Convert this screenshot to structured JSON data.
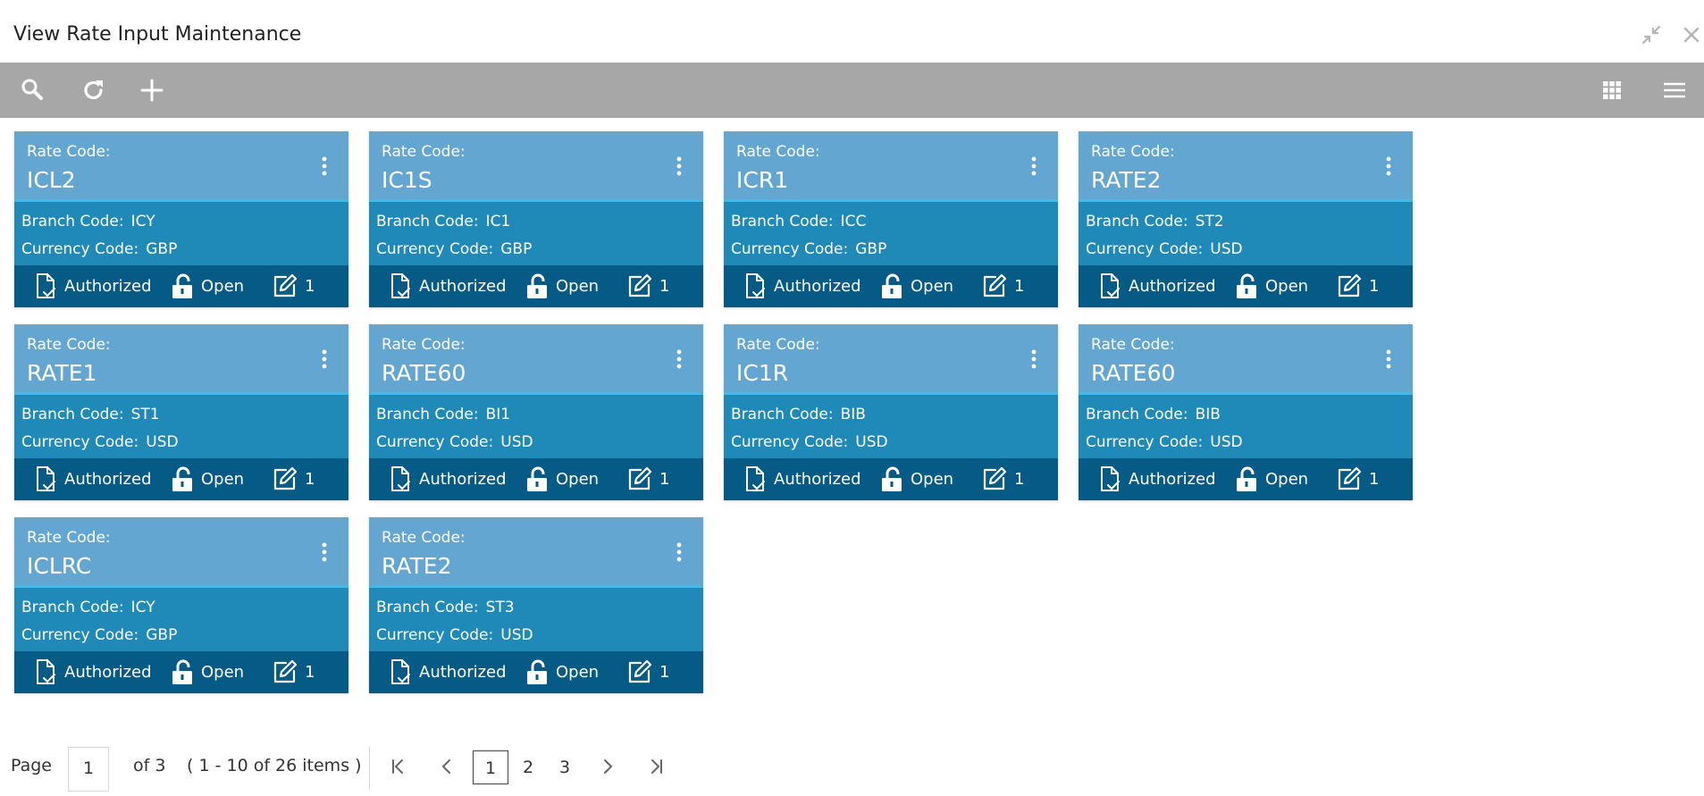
{
  "window": {
    "title": "View Rate Input Maintenance"
  },
  "toolbar": {
    "search_icon": "search-icon",
    "refresh_icon": "refresh-icon",
    "add_icon": "plus-icon",
    "tile_view_icon": "grid-icon",
    "list_view_icon": "menu-icon"
  },
  "cards": [
    {
      "rate_label": "Rate Code:",
      "rate_code": "ICL2",
      "branch_label": "Branch Code:",
      "branch_code": "ICY",
      "currency_label": "Currency Code:",
      "currency_code": "GBP",
      "auth_status": "Authorized",
      "record_status": "Open",
      "mod_no": "1"
    },
    {
      "rate_label": "Rate Code:",
      "rate_code": "IC1S",
      "branch_label": "Branch Code:",
      "branch_code": "IC1",
      "currency_label": "Currency Code:",
      "currency_code": "GBP",
      "auth_status": "Authorized",
      "record_status": "Open",
      "mod_no": "1"
    },
    {
      "rate_label": "Rate Code:",
      "rate_code": "ICR1",
      "branch_label": "Branch Code:",
      "branch_code": "ICC",
      "currency_label": "Currency Code:",
      "currency_code": "GBP",
      "auth_status": "Authorized",
      "record_status": "Open",
      "mod_no": "1"
    },
    {
      "rate_label": "Rate Code:",
      "rate_code": "RATE2",
      "branch_label": "Branch Code:",
      "branch_code": "ST2",
      "currency_label": "Currency Code:",
      "currency_code": "USD",
      "auth_status": "Authorized",
      "record_status": "Open",
      "mod_no": "1"
    },
    {
      "rate_label": "Rate Code:",
      "rate_code": "RATE1",
      "branch_label": "Branch Code:",
      "branch_code": "ST1",
      "currency_label": "Currency Code:",
      "currency_code": "USD",
      "auth_status": "Authorized",
      "record_status": "Open",
      "mod_no": "1"
    },
    {
      "rate_label": "Rate Code:",
      "rate_code": "RATE60",
      "branch_label": "Branch Code:",
      "branch_code": "BI1",
      "currency_label": "Currency Code:",
      "currency_code": "USD",
      "auth_status": "Authorized",
      "record_status": "Open",
      "mod_no": "1"
    },
    {
      "rate_label": "Rate Code:",
      "rate_code": "IC1R",
      "branch_label": "Branch Code:",
      "branch_code": "BIB",
      "currency_label": "Currency Code:",
      "currency_code": "USD",
      "auth_status": "Authorized",
      "record_status": "Open",
      "mod_no": "1"
    },
    {
      "rate_label": "Rate Code:",
      "rate_code": "RATE60",
      "branch_label": "Branch Code:",
      "branch_code": "BIB",
      "currency_label": "Currency Code:",
      "currency_code": "USD",
      "auth_status": "Authorized",
      "record_status": "Open",
      "mod_no": "1"
    },
    {
      "rate_label": "Rate Code:",
      "rate_code": "ICLRC",
      "branch_label": "Branch Code:",
      "branch_code": "ICY",
      "currency_label": "Currency Code:",
      "currency_code": "GBP",
      "auth_status": "Authorized",
      "record_status": "Open",
      "mod_no": "1"
    },
    {
      "rate_label": "Rate Code:",
      "rate_code": "RATE2",
      "branch_label": "Branch Code:",
      "branch_code": "ST3",
      "currency_label": "Currency Code:",
      "currency_code": "USD",
      "auth_status": "Authorized",
      "record_status": "Open",
      "mod_no": "1"
    }
  ],
  "pagination": {
    "page_label": "Page",
    "current_page": "1",
    "of_label": "of 3",
    "items_summary": "( 1 - 10 of 26 items )",
    "pages": [
      "1",
      "2",
      "3"
    ],
    "active_page": "1"
  },
  "colors": {
    "toolbar_bg": "#a7a7a7",
    "card_header": "#63a6d1",
    "card_body": "#1f8ab8",
    "card_footer": "#055b85",
    "card_accent": "#3dbbe9"
  }
}
